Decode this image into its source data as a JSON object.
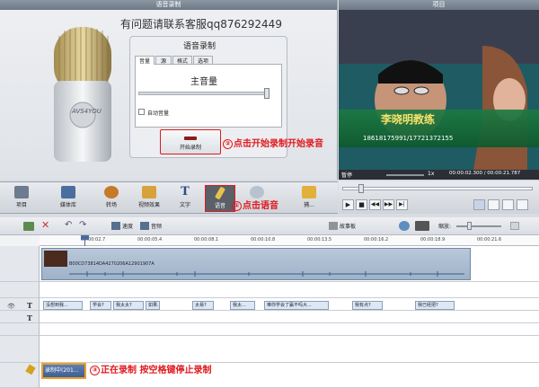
{
  "left_panel": {
    "title": "语音录制",
    "watermark": "有问题请联系客服qq876292449"
  },
  "mic": {
    "logo": "AVS4YOU"
  },
  "rec_dialog": {
    "title": "语音录制",
    "tabs": [
      "音量",
      "源",
      "格式",
      "选项"
    ],
    "main_volume_label": "主音量",
    "auto_volume_label": "自动音量",
    "start_button_label": "开始录制"
  },
  "right_panel": {
    "title": "项目",
    "video_caption_name": "李晓明教练",
    "video_caption_phone": "18618175991/17721372155",
    "pause_label": "暂停",
    "speed": "1x",
    "time_readout": "00:00:02.300 / 00:00:21.787"
  },
  "annotations": {
    "a1": "点击开始录制开始录音",
    "a2": "点击语音",
    "a3": "正在录制 按空格键停止录制",
    "n1": "②",
    "n2": "①",
    "n3": "③"
  },
  "toolbar": {
    "items": [
      "项目",
      "媒体库",
      "转场",
      "视频效果",
      "文字",
      "语音",
      "",
      "捕..."
    ]
  },
  "timeline_tools": {
    "speed": "速度",
    "audio": "音频",
    "storyboard": "故事板",
    "zoom": "缩放:"
  },
  "ruler": [
    "00:00:02.7",
    "00:00:05.4",
    "00:00:08.1",
    "00:00:10.8",
    "00:00:13.5",
    "00:00:16.2",
    "00:00:18.9",
    "00:00:21.6"
  ],
  "video_track_label": "B00CD73814DA4270206A12901907A",
  "subtitle_clips": [
    "没想到我...",
    "学会?",
    "我太太?",
    "如果...",
    "太易?",
    "我太...",
    "难你学会了赢不吗大...",
    "我有点?",
    "我已经把?"
  ],
  "recording_clip": "录制中(201..."
}
